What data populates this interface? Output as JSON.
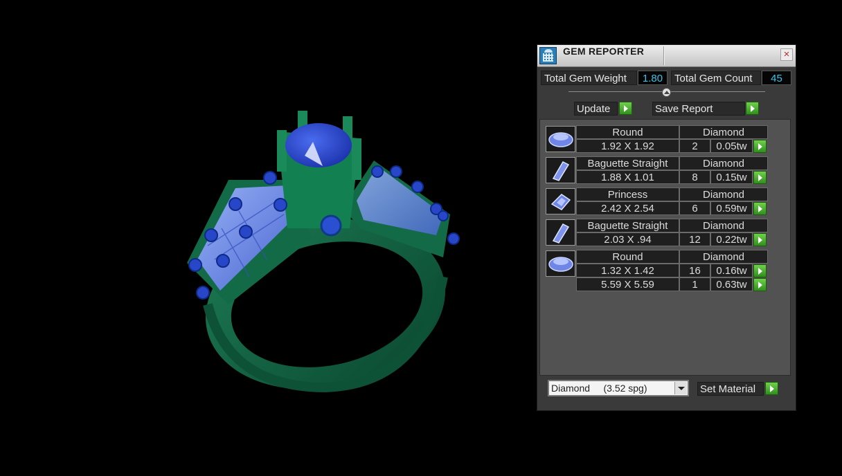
{
  "panel": {
    "title": "GEM REPORTER",
    "close_label": "×",
    "total_weight_label": "Total Gem Weight",
    "total_weight_value": "1.80",
    "total_count_label": "Total Gem Count",
    "total_count_value": "45",
    "update_label": "Update",
    "save_report_label": "Save Report",
    "set_material_label": "Set Material",
    "material_select_value": "Diamond     (3.52 spg)"
  },
  "gem_groups": [
    {
      "cut": "Round",
      "material": "Diamond",
      "icon": "round-gem-icon",
      "rows": [
        {
          "size": "1.92 X 1.92",
          "count": "2",
          "weight": "0.05tw"
        }
      ]
    },
    {
      "cut": "Baguette Straight",
      "material": "Diamond",
      "icon": "baguette-gem-icon",
      "rows": [
        {
          "size": "1.88 X 1.01",
          "count": "8",
          "weight": "0.15tw"
        }
      ]
    },
    {
      "cut": "Princess",
      "material": "Diamond",
      "icon": "princess-gem-icon",
      "rows": [
        {
          "size": "2.42 X 2.54",
          "count": "6",
          "weight": "0.59tw"
        }
      ]
    },
    {
      "cut": "Baguette Straight",
      "material": "Diamond",
      "icon": "baguette-gem-icon",
      "rows": [
        {
          "size": "2.03 X .94",
          "count": "12",
          "weight": "0.22tw"
        }
      ]
    },
    {
      "cut": "Round",
      "material": "Diamond",
      "icon": "round-gem-icon",
      "rows": [
        {
          "size": "1.32 X 1.42",
          "count": "16",
          "weight": "0.16tw"
        },
        {
          "size": "5.59 X 5.59",
          "count": "1",
          "weight": "0.63tw"
        }
      ]
    }
  ],
  "colors": {
    "band": "#0f5e3e",
    "gem": "#2a4fd0",
    "accent_value": "#3fc3e8",
    "go_button": "#3fa52a"
  }
}
